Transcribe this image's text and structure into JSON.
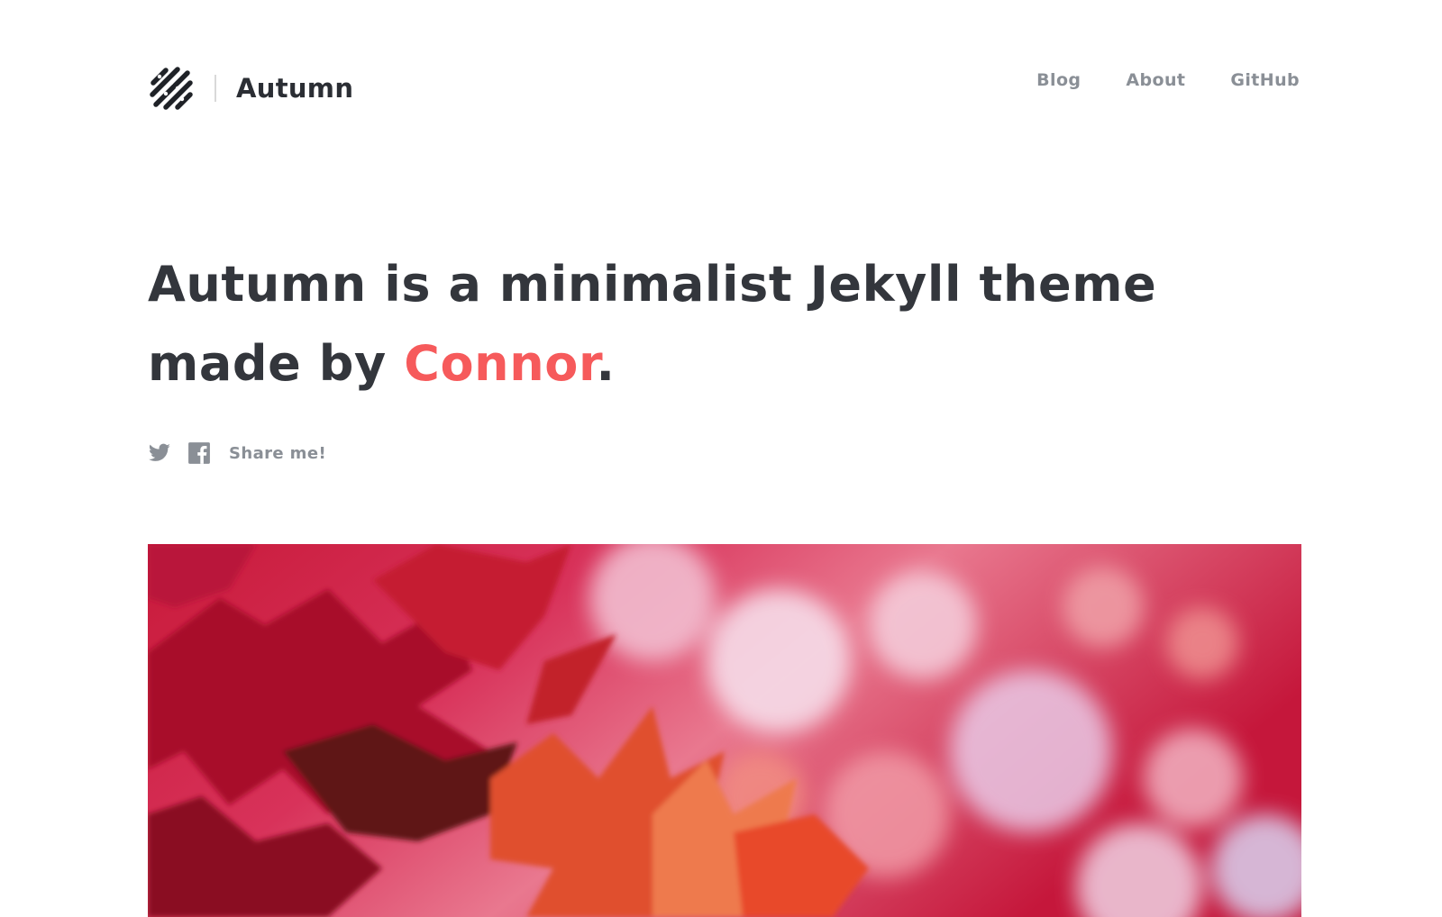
{
  "header": {
    "brand_name": "Autumn",
    "logo_icon": "striped-logo-icon",
    "nav": [
      {
        "label": "Blog"
      },
      {
        "label": "About"
      },
      {
        "label": "GitHub"
      }
    ]
  },
  "hero": {
    "headline_prefix": "Autumn is a minimalist Jekyll theme made by ",
    "headline_link": "Connor",
    "headline_suffix": ".",
    "share_label": "Share me!",
    "share_icons": [
      "twitter-icon",
      "facebook-icon"
    ]
  },
  "colors": {
    "accent": "#f65a5b",
    "text": "#33363c",
    "muted": "#8a8f96"
  }
}
